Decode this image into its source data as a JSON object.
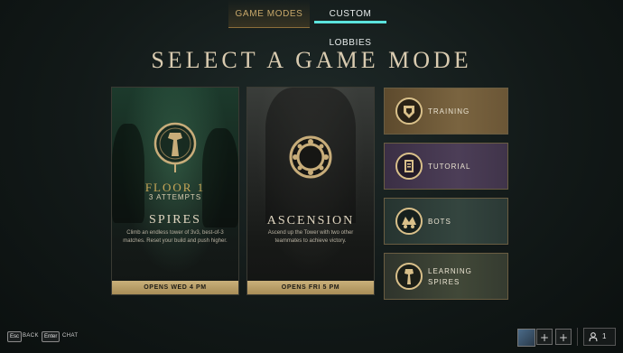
{
  "tabs": {
    "game_modes": "GAME MODES",
    "custom_lobbies": "CUSTOM LOBBIES"
  },
  "title": "SELECT A GAME MODE",
  "cards": {
    "spires": {
      "floor": "FLOOR 1",
      "attempts": "3 ATTEMPTS",
      "name": "SPIRES",
      "description": "Climb an endless tower of 3v3, best-of-3 matches. Reset your build and push higher.",
      "footer": "OPENS WED 4 PM"
    },
    "ascension": {
      "name": "ASCENSION",
      "description": "Ascend up the Tower with two other teammates to achieve victory.",
      "footer": "OPENS FRI 5 PM"
    }
  },
  "modes": {
    "training": "TRAINING",
    "tutorial": "TUTORIAL",
    "bots": "BOTS",
    "learning_line1": "LEARNING",
    "learning_line2": "SPIRES"
  },
  "bottom": {
    "esc_key": "Esc",
    "esc_label": "BACK",
    "enter_key": "Enter",
    "enter_label": "CHAT",
    "add_glyph": "+",
    "party_count": "1"
  },
  "colors": {
    "accent_teal": "#5be3dd",
    "gold": "#c9a858",
    "footer_gold": "#c9b07a"
  }
}
